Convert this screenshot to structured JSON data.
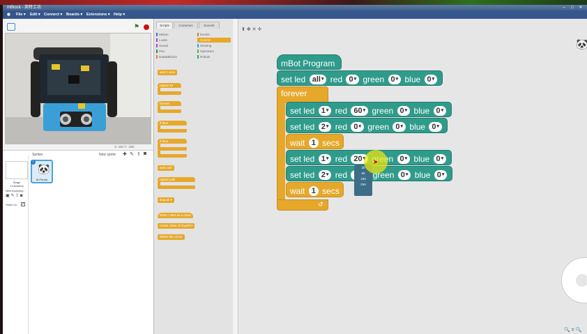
{
  "window": {
    "title": "mBlock - 英特工坊"
  },
  "menu": [
    "File ▾",
    "Edit ▾",
    "Connect ▾",
    "Boards ▾",
    "Extensions ▾",
    "Help ▾"
  ],
  "stage_info": {
    "coords": "X: 240  Y: -180"
  },
  "sprites_pane": {
    "sprites_label": "Sprites",
    "new_sprite_label": "New sprite:",
    "stage_label": "Stage\n1 backdrop",
    "sprite_name": "M-Panda",
    "new_backdrop_label": "New backdrop:",
    "video_label": "Video on:"
  },
  "palette": {
    "tabs": [
      "Scripts",
      "Costumes",
      "Sounds"
    ],
    "categories_left": [
      {
        "name": "Motion",
        "color": "#4a6cd4"
      },
      {
        "name": "Looks",
        "color": "#8a55d7"
      },
      {
        "name": "Sound",
        "color": "#bb42c3"
      },
      {
        "name": "Pen",
        "color": "#0e9a6c"
      },
      {
        "name": "Data&Blocks",
        "color": "#ee7d16"
      }
    ],
    "categories_right": [
      {
        "name": "Events",
        "color": "#c88330"
      },
      {
        "name": "Control",
        "color": "#e1a91a"
      },
      {
        "name": "Sensing",
        "color": "#2ca5e2"
      },
      {
        "name": "Operators",
        "color": "#5cb712"
      },
      {
        "name": "Robots",
        "color": "#2f9b8b"
      }
    ],
    "selected_category": "Control",
    "blocks": {
      "wait": "wait 1 secs",
      "repeat": "repeat 10",
      "forever": "forever",
      "if_then": "if then",
      "if_then_else": "if then",
      "wait_until": "wait until",
      "repeat_until": "repeat until",
      "stop": "stop all ▾",
      "when_clone": "when I start as a clone",
      "create_clone": "create clone of myself ▾",
      "delete_clone": "delete this clone"
    }
  },
  "script": {
    "hat": "mBot Program",
    "set_led_label": "set  led",
    "red_label": "red",
    "green_label": "green",
    "blue_label": "blue",
    "forever_label": "forever",
    "wait_label": "wait",
    "secs_label": "secs",
    "line0": {
      "led": "all",
      "red": "0",
      "green": "0",
      "blue": "0"
    },
    "line1": {
      "led": "1",
      "red": "60",
      "green": "0",
      "blue": "0"
    },
    "line2": {
      "led": "2",
      "red": "0",
      "green": "0",
      "blue": "0"
    },
    "wait1": "1",
    "line3": {
      "led": "1",
      "red": "20",
      "green": "0",
      "blue": "0"
    },
    "line4": {
      "led": "2",
      "red": "",
      "green": "0",
      "blue": "0"
    },
    "wait2": "1",
    "loop_arrow": "↺"
  },
  "dropdown_options": [
    "20",
    "60",
    "150",
    "255"
  ],
  "zoom": {
    "minus": "🔍",
    "equal": "=",
    "plus": "🔍"
  }
}
